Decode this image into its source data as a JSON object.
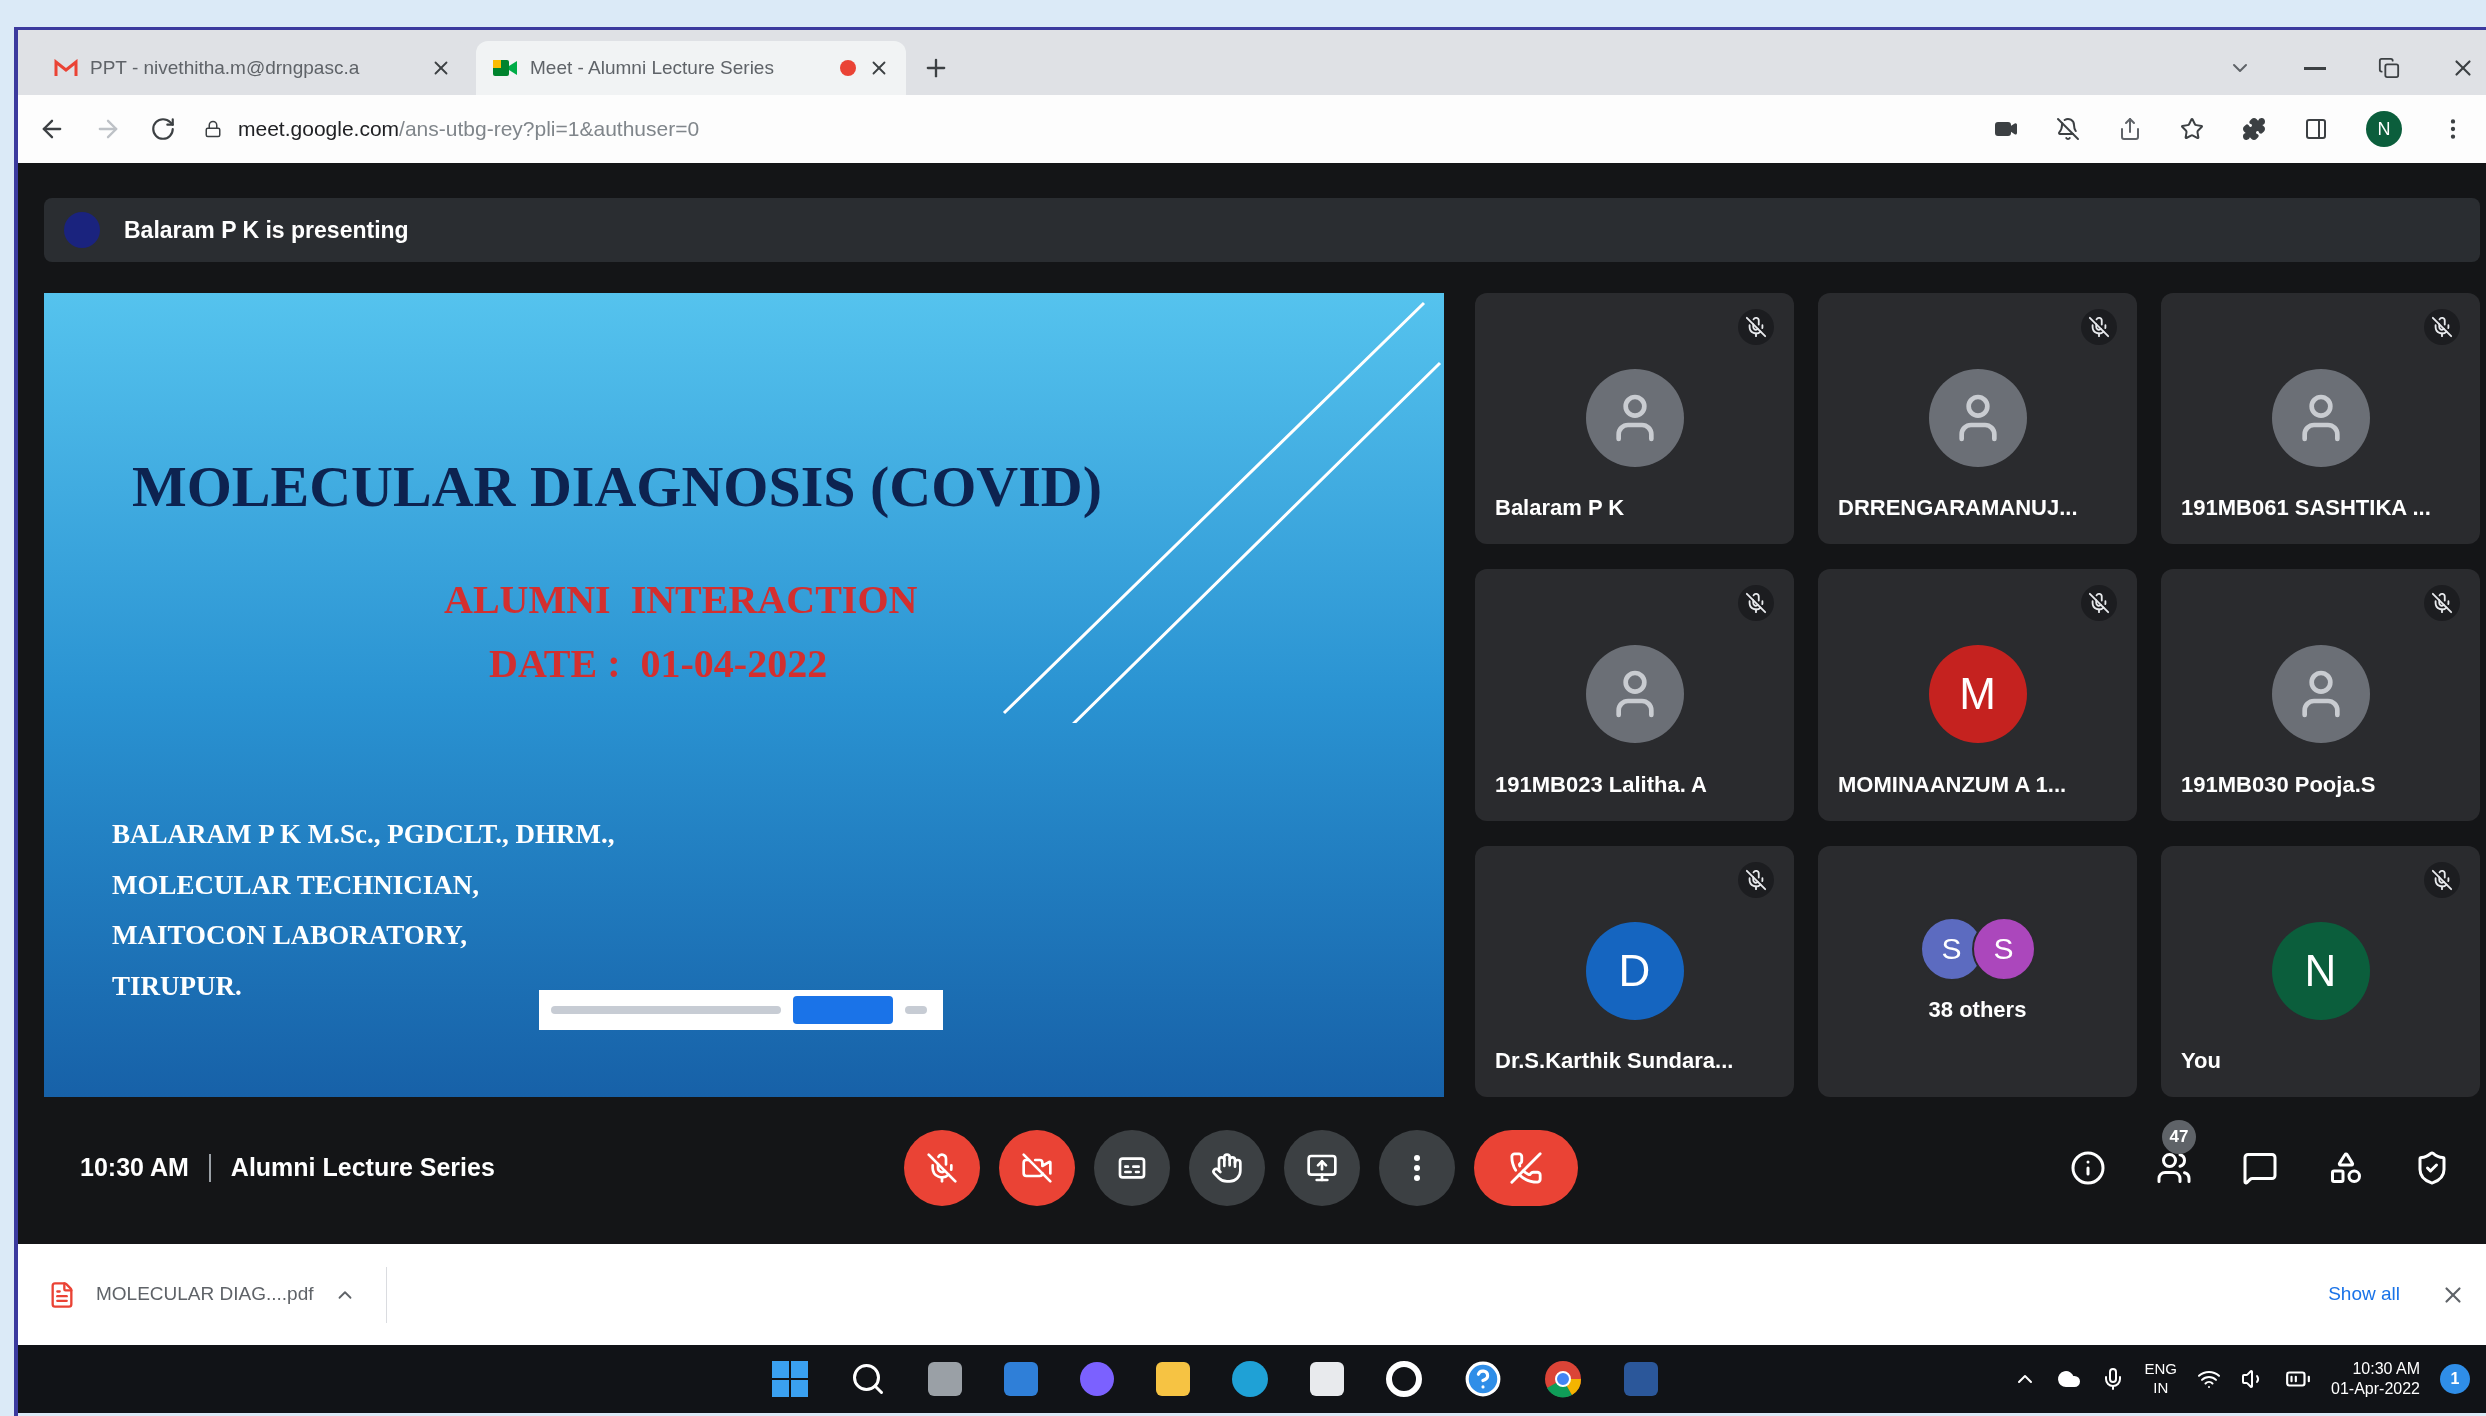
{
  "browser": {
    "tabs": [
      {
        "title": "PPT - nivethitha.m@drngpasc.a",
        "selected": false,
        "recording": false
      },
      {
        "title": "Meet - Alumni Lecture Series",
        "selected": true,
        "recording": true
      }
    ],
    "url_host": "meet.google.com",
    "url_path": "/ans-utbg-rey?pli=1&authuser=0",
    "profile": "N"
  },
  "meet": {
    "presenting_banner": "Balaram P K is presenting",
    "slide": {
      "title": "MOLECULAR DIAGNOSIS (COVID)",
      "subtitle_lines": [
        "ALUMNI  INTERACTION",
        "DATE :  01-04-2022"
      ],
      "author_lines": [
        "BALARAM P K M.Sc., PGDCLT., DHRM.,",
        "MOLECULAR TECHNICIAN,",
        "MAITOCON LABORATORY,",
        "TIRUPUR."
      ]
    },
    "tiles": [
      {
        "kind": "person",
        "name": "Balaram P K",
        "muted": true
      },
      {
        "kind": "person",
        "name": "DRRENGARAMANUJ...",
        "muted": true
      },
      {
        "kind": "person",
        "name": "191MB061 SASHTIKA ...",
        "muted": true
      },
      {
        "kind": "person",
        "name": "191MB023 Lalitha. A",
        "muted": true
      },
      {
        "kind": "person",
        "name": "MOMINAANZUM A 1...",
        "letter": "M",
        "color": "#c5221f",
        "muted": true
      },
      {
        "kind": "person",
        "name": "191MB030 Pooja.S",
        "muted": true
      },
      {
        "kind": "person",
        "name": "Dr.S.Karthik Sundara...",
        "letter": "D",
        "color": "#1565c0",
        "muted": true
      },
      {
        "kind": "others",
        "label": "38 others",
        "avatars": [
          {
            "letter": "S",
            "color": "#5c6bc0"
          },
          {
            "letter": "S",
            "color": "#ab47bc"
          }
        ]
      },
      {
        "kind": "person",
        "name": "You",
        "letter": "N",
        "color": "#0b5e3c",
        "muted": true
      }
    ],
    "time": "10:30 AM",
    "meeting_title": "Alumni Lecture Series",
    "controls": [
      {
        "kind": "mic",
        "on": false
      },
      {
        "kind": "camera",
        "on": false
      },
      {
        "kind": "captions"
      },
      {
        "kind": "raise_hand"
      },
      {
        "kind": "present"
      },
      {
        "kind": "more"
      },
      {
        "kind": "end_call"
      }
    ],
    "participant_count": "47"
  },
  "download_bar": {
    "file": "MOLECULAR DIAG....pdf",
    "show_all": "Show all"
  },
  "taskbar": {
    "language": "ENG",
    "region": "IN",
    "time": "10:30 AM",
    "date": "01-Apr-2022",
    "notifications": "1"
  }
}
